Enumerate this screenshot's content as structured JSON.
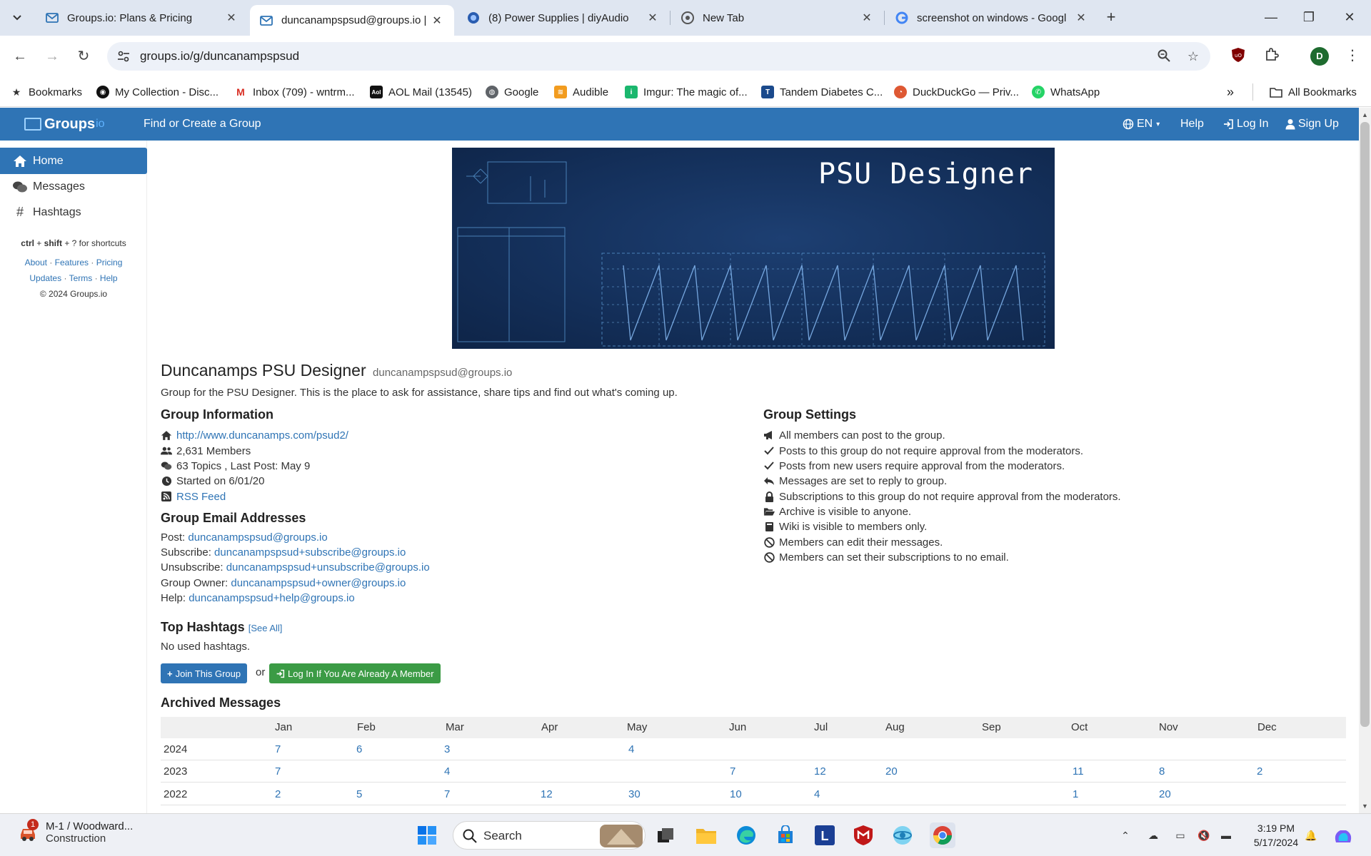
{
  "browser": {
    "tabs": [
      {
        "title": "Groups.io: Plans & Pricing",
        "active": false
      },
      {
        "title": "duncanampspsud@groups.io | H",
        "active": true
      },
      {
        "title": "(8) Power Supplies | diyAudio",
        "active": false
      },
      {
        "title": "New Tab",
        "active": false
      },
      {
        "title": "screenshot on windows - Googl",
        "active": false
      }
    ],
    "url": "groups.io/g/duncanampspsud",
    "bookmarks_label": "Bookmarks",
    "bookmarks": [
      "My Collection - Disc...",
      "Inbox (709) - wntrm...",
      "AOL Mail (13545)",
      "Google",
      "Audible",
      "Imgur: The magic of...",
      "Tandem Diabetes C...",
      "DuckDuckGo — Priv...",
      "WhatsApp"
    ],
    "all_bookmarks": "All Bookmarks",
    "profile_initial": "D"
  },
  "site": {
    "logo": "Groups",
    "logo_suffix": "io",
    "find_group": "Find or Create a Group",
    "lang": "EN",
    "help": "Help",
    "login": "Log In",
    "signup": "Sign Up",
    "accent": "#2f74b5"
  },
  "sidebar": {
    "items": [
      {
        "label": "Home",
        "icon": "home-icon"
      },
      {
        "label": "Messages",
        "icon": "messages-icon"
      },
      {
        "label": "Hashtags",
        "icon": "hashtag-icon"
      }
    ],
    "shortcut_ctrl": "ctrl",
    "shortcut_plus1": " + ",
    "shortcut_shift": "shift",
    "shortcut_rest": " + ? for shortcuts",
    "links_row1": [
      "About",
      "Features",
      "Pricing"
    ],
    "links_row2": [
      "Updates",
      "Terms",
      "Help"
    ],
    "copyright": "© 2024 Groups.io"
  },
  "banner": {
    "title": "PSU Designer"
  },
  "group": {
    "name": "Duncanamps PSU Designer",
    "email": "duncanampspsud@groups.io",
    "description": "Group for the PSU Designer. This is the place to ask for assistance, share tips and find out what's coming up.",
    "info_heading": "Group Information",
    "website": "http://www.duncanamps.com/psud2/",
    "members": "2,631 Members",
    "topics": "63 Topics , Last Post: May 9",
    "started": "Started on 6/01/20",
    "rss": "RSS Feed",
    "emails_heading": "Group Email Addresses",
    "emails": [
      {
        "label": "Post: ",
        "value": "duncanampspsud@groups.io"
      },
      {
        "label": "Subscribe: ",
        "value": "duncanampspsud+subscribe@groups.io"
      },
      {
        "label": "Unsubscribe: ",
        "value": "duncanampspsud+unsubscribe@groups.io"
      },
      {
        "label": "Group Owner: ",
        "value": "duncanampspsud+owner@groups.io"
      },
      {
        "label": "Help: ",
        "value": "duncanampspsud+help@groups.io"
      }
    ],
    "settings_heading": "Group Settings",
    "settings": [
      {
        "text": "All members can post to the group.",
        "icon": "megaphone-icon"
      },
      {
        "text": "Posts to this group do not require approval from the moderators.",
        "icon": "check-icon"
      },
      {
        "text": "Posts from new users require approval from the moderators.",
        "icon": "check-icon"
      },
      {
        "text": "Messages are set to reply to group.",
        "icon": "reply-icon"
      },
      {
        "text": "Subscriptions to this group do not require approval from the moderators.",
        "icon": "lock-icon"
      },
      {
        "text": "Archive is visible to anyone.",
        "icon": "folder-open-icon"
      },
      {
        "text": "Wiki is visible to members only.",
        "icon": "book-icon"
      },
      {
        "text": "Members can edit their messages.",
        "icon": "ban-icon"
      },
      {
        "text": "Members can set their subscriptions to no email.",
        "icon": "ban-icon"
      }
    ],
    "hashtags_heading": "Top Hashtags",
    "see_all": "[See All]",
    "no_hashtags": "No used hashtags.",
    "join_button": "Join This Group",
    "or": "or",
    "login_button": "Log In If You Are Already A Member",
    "archive_heading": "Archived Messages"
  },
  "archive": {
    "months": [
      "Jan",
      "Feb",
      "Mar",
      "Apr",
      "May",
      "Jun",
      "Jul",
      "Aug",
      "Sep",
      "Oct",
      "Nov",
      "Dec"
    ],
    "rows": [
      {
        "year": "2024",
        "counts": [
          "7",
          "6",
          "3",
          "",
          "4",
          "",
          "",
          "",
          "",
          "",
          "",
          ""
        ]
      },
      {
        "year": "2023",
        "counts": [
          "7",
          "",
          "4",
          "",
          "",
          "7",
          "12",
          "20",
          "",
          "11",
          "8",
          "2"
        ]
      },
      {
        "year": "2022",
        "counts": [
          "2",
          "5",
          "7",
          "12",
          "30",
          "10",
          "4",
          "",
          "",
          "1",
          "20",
          ""
        ]
      }
    ]
  },
  "taskbar": {
    "news_title": "M-1 / Woodward...",
    "news_sub": "Construction",
    "news_badge": "1",
    "search": "Search",
    "time": "3:19 PM",
    "date": "5/17/2024"
  }
}
